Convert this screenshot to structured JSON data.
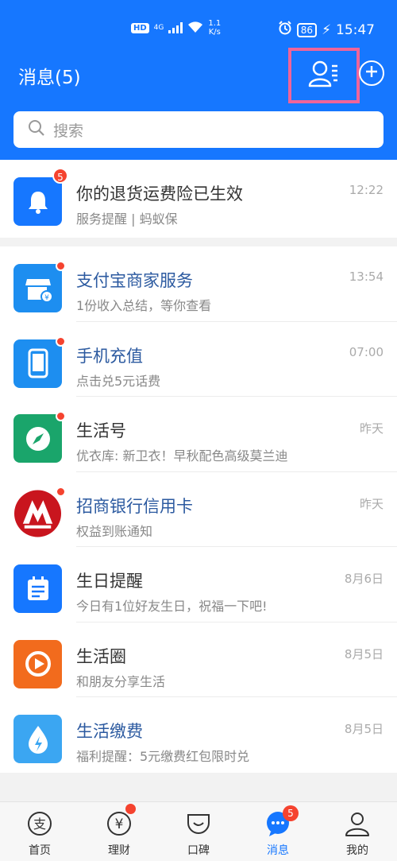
{
  "status_bar": {
    "hd": "HD",
    "network": "4G",
    "speed_value": "1.1",
    "speed_unit": "K/s",
    "battery": "86",
    "time": "15:47"
  },
  "header": {
    "title": "消息(5)"
  },
  "search": {
    "placeholder": "搜索"
  },
  "pinned": [
    {
      "name": "你的退货运费险已生效",
      "subtitle": "服务提醒 | 蚂蚁保",
      "time": "12:22",
      "badge": "5",
      "icon": "bell-icon",
      "color": "#1677ff"
    }
  ],
  "messages": [
    {
      "name": "支付宝商家服务",
      "subtitle": "1份收入总结，等你查看",
      "time": "13:54",
      "icon": "shop-icon",
      "color": "#1d8ef0"
    },
    {
      "name": "手机充值",
      "subtitle": "点击兑5元话费",
      "time": "07:00",
      "icon": "phone-icon",
      "color": "#1d8ef0"
    },
    {
      "name": "生活号",
      "subtitle": "优衣库: 新卫衣！早秋配色高级莫兰迪",
      "time": "昨天",
      "icon": "compass-icon",
      "color": "#1aa56b"
    },
    {
      "name": "招商银行信用卡",
      "subtitle": "权益到账通知",
      "time": "昨天",
      "icon": "cmb-logo-icon",
      "color": "#c9151e"
    },
    {
      "name": "生日提醒",
      "subtitle": "今日有1位好友生日，祝福一下吧!",
      "time": "8月6日",
      "icon": "calendar-icon",
      "color": "#1677ff"
    },
    {
      "name": "生活圈",
      "subtitle": "和朋友分享生活",
      "time": "8月5日",
      "icon": "play-circle-icon",
      "color": "#f26b1d"
    },
    {
      "name": "生活缴费",
      "subtitle": "福利提醒：5元缴费红包限时兑",
      "time": "8月5日",
      "icon": "water-drop-icon",
      "color": "#3ba6f2"
    }
  ],
  "tabs": [
    {
      "label": "首页",
      "icon": "alipay-home-icon"
    },
    {
      "label": "理财",
      "icon": "yuan-icon"
    },
    {
      "label": "口碑",
      "icon": "koubei-icon"
    },
    {
      "label": "消息",
      "icon": "chat-bubble-icon",
      "badge": "5",
      "active": true
    },
    {
      "label": "我的",
      "icon": "person-icon"
    }
  ]
}
